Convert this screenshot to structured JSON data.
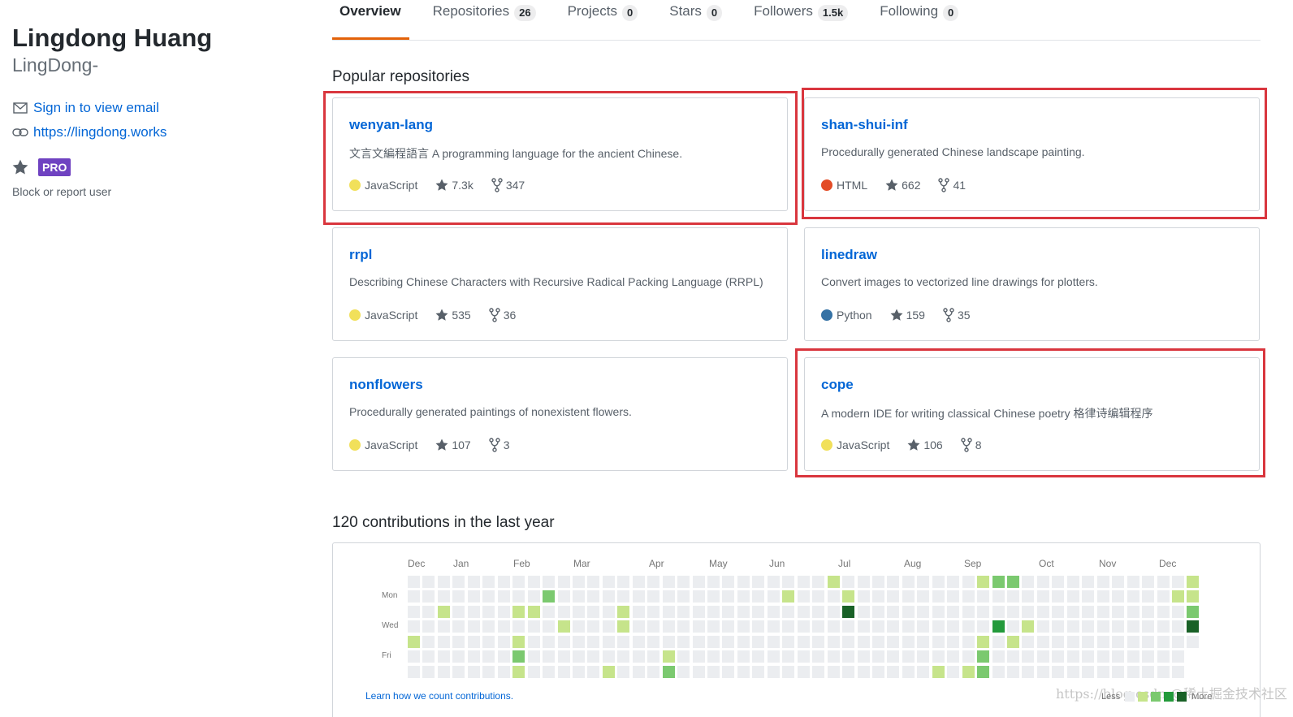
{
  "profile": {
    "fullname": "Lingdong Huang",
    "username": "LingDong-",
    "email_link": "Sign in to view email",
    "website": "https://lingdong.works",
    "pro_badge": "PRO",
    "block_link": "Block or report user"
  },
  "tabs": [
    {
      "label": "Overview",
      "count": null
    },
    {
      "label": "Repositories",
      "count": "26"
    },
    {
      "label": "Projects",
      "count": "0"
    },
    {
      "label": "Stars",
      "count": "0"
    },
    {
      "label": "Followers",
      "count": "1.5k"
    },
    {
      "label": "Following",
      "count": "0"
    }
  ],
  "popular": {
    "title": "Popular repositories",
    "repos": [
      {
        "name": "wenyan-lang",
        "desc": "文言文編程語言 A programming language for the ancient Chinese.",
        "lang": "JavaScript",
        "lang_color": "#f1e05a",
        "stars": "7.3k",
        "forks": "347",
        "highlighted": true
      },
      {
        "name": "shan-shui-inf",
        "desc": "Procedurally generated Chinese landscape painting.",
        "lang": "HTML",
        "lang_color": "#e34c26",
        "stars": "662",
        "forks": "41",
        "highlighted": true
      },
      {
        "name": "rrpl",
        "desc": "Describing Chinese Characters with Recursive Radical Packing Language (RRPL)",
        "lang": "JavaScript",
        "lang_color": "#f1e05a",
        "stars": "535",
        "forks": "36",
        "highlighted": false
      },
      {
        "name": "linedraw",
        "desc": "Convert images to vectorized line drawings for plotters.",
        "lang": "Python",
        "lang_color": "#3572A5",
        "stars": "159",
        "forks": "35",
        "highlighted": false
      },
      {
        "name": "nonflowers",
        "desc": "Procedurally generated paintings of nonexistent flowers.",
        "lang": "JavaScript",
        "lang_color": "#f1e05a",
        "stars": "107",
        "forks": "3",
        "highlighted": false
      },
      {
        "name": "cope",
        "desc": "A modern IDE for writing classical Chinese poetry 格律诗编辑程序",
        "lang": "JavaScript",
        "lang_color": "#f1e05a",
        "stars": "106",
        "forks": "8",
        "highlighted": true
      }
    ]
  },
  "contributions": {
    "title": "120 contributions in the last year",
    "months": [
      "Dec",
      "Jan",
      "Feb",
      "Mar",
      "Apr",
      "May",
      "Jun",
      "Jul",
      "Aug",
      "Sep",
      "Oct",
      "Nov",
      "Dec"
    ],
    "weekdays": [
      "Mon",
      "Wed",
      "Fri"
    ],
    "learn_link": "Learn how we count contributions.",
    "legend_less": "Less",
    "legend_more": "More",
    "colors": [
      "#ebedf0",
      "#c6e48b",
      "#7bc96f",
      "#239a3b",
      "#196127"
    ],
    "active_cells": [
      {
        "week": 0,
        "day": 4,
        "level": 1
      },
      {
        "week": 2,
        "day": 2,
        "level": 1
      },
      {
        "week": 7,
        "day": 2,
        "level": 1
      },
      {
        "week": 7,
        "day": 4,
        "level": 1
      },
      {
        "week": 7,
        "day": 5,
        "level": 2
      },
      {
        "week": 7,
        "day": 6,
        "level": 1
      },
      {
        "week": 8,
        "day": 2,
        "level": 1
      },
      {
        "week": 9,
        "day": 1,
        "level": 2
      },
      {
        "week": 10,
        "day": 3,
        "level": 1
      },
      {
        "week": 13,
        "day": 6,
        "level": 1
      },
      {
        "week": 14,
        "day": 2,
        "level": 1
      },
      {
        "week": 14,
        "day": 3,
        "level": 1
      },
      {
        "week": 17,
        "day": 5,
        "level": 1
      },
      {
        "week": 17,
        "day": 6,
        "level": 2
      },
      {
        "week": 25,
        "day": 1,
        "level": 1
      },
      {
        "week": 28,
        "day": 0,
        "level": 1
      },
      {
        "week": 29,
        "day": 1,
        "level": 1
      },
      {
        "week": 29,
        "day": 2,
        "level": 4
      },
      {
        "week": 35,
        "day": 6,
        "level": 1
      },
      {
        "week": 37,
        "day": 6,
        "level": 1
      },
      {
        "week": 38,
        "day": 0,
        "level": 1
      },
      {
        "week": 38,
        "day": 4,
        "level": 1
      },
      {
        "week": 38,
        "day": 5,
        "level": 2
      },
      {
        "week": 38,
        "day": 6,
        "level": 2
      },
      {
        "week": 39,
        "day": 0,
        "level": 2
      },
      {
        "week": 39,
        "day": 3,
        "level": 3
      },
      {
        "week": 40,
        "day": 0,
        "level": 2
      },
      {
        "week": 40,
        "day": 4,
        "level": 1
      },
      {
        "week": 41,
        "day": 3,
        "level": 1
      },
      {
        "week": 51,
        "day": 1,
        "level": 1
      },
      {
        "week": 52,
        "day": 0,
        "level": 1
      },
      {
        "week": 52,
        "day": 1,
        "level": 1
      },
      {
        "week": 52,
        "day": 2,
        "level": 2
      },
      {
        "week": 52,
        "day": 3,
        "level": 4
      }
    ]
  },
  "watermark": "https://blog.csdn @稀土掘金技术社区"
}
